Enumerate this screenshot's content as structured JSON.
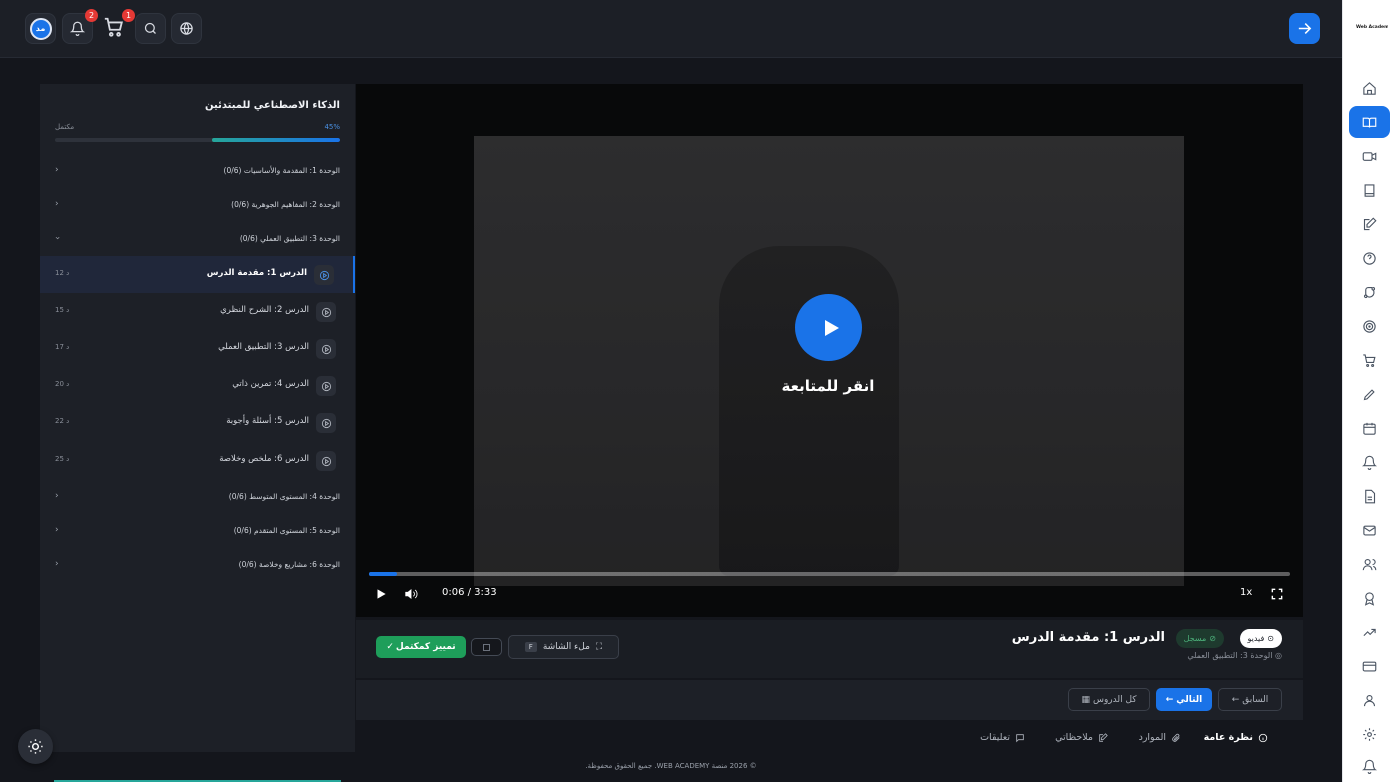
{
  "header": {
    "avatar_initials": "مد",
    "notifications_count": "2",
    "cart_count": "1"
  },
  "sidebar_logo": "Web Academy",
  "course": {
    "title": "الذكاء الاصطناعي للمبتدئين",
    "progress_label": "مكتمل",
    "progress_pct_text": "45%",
    "progress_value": 0.45,
    "units": [
      {
        "title": "الوحدة 1: المقدمة والأساسيات (0/6)",
        "expanded": false
      },
      {
        "title": "الوحدة 2: المفاهيم الجوهرية (0/6)",
        "expanded": false
      },
      {
        "title": "الوحدة 3: التطبيق العملي (0/6)",
        "expanded": true
      },
      {
        "title": "الوحدة 4: المستوى المتوسط (0/6)",
        "expanded": false
      },
      {
        "title": "الوحدة 5: المستوى المتقدم (0/6)",
        "expanded": false
      },
      {
        "title": "الوحدة 6: مشاريع وخلاصة (0/6)",
        "expanded": false
      }
    ],
    "lessons": [
      {
        "title": "الدرس 1: مقدمة الدرس",
        "duration": "12 د",
        "active": true
      },
      {
        "title": "الدرس 2: الشرح النظري",
        "duration": "15 د",
        "active": false
      },
      {
        "title": "الدرس 3: التطبيق العملي",
        "duration": "17 د",
        "active": false
      },
      {
        "title": "الدرس 4: تمرين ذاتي",
        "duration": "20 د",
        "active": false
      },
      {
        "title": "الدرس 5: أسئلة وأجوبة",
        "duration": "22 د",
        "active": false
      },
      {
        "title": "الدرس 6: ملخص وخلاصة",
        "duration": "25 د",
        "active": false
      }
    ]
  },
  "player": {
    "overlay_text": "انقر للمتابعة",
    "time": "0:06 / 3:33",
    "speed": "1x",
    "played_fraction": 0.03
  },
  "lesson_info": {
    "title": "الدرس 1: مقدمة الدرس",
    "tag_video": "فيديو",
    "tag_enrolled": "مسجل",
    "unit_crumb": "الوحدة 3: التطبيق العملي",
    "complete_label": "تمييز كمكتمل",
    "fullscreen_label": "ملء الشاشة",
    "fullscreen_key": "F"
  },
  "nav": {
    "prev": "السابق",
    "next": "التالي",
    "all_lessons": "كل الدروس"
  },
  "tabs": [
    {
      "label": "نظرة عامة",
      "active": true
    },
    {
      "label": "الموارد",
      "active": false
    },
    {
      "label": "ملاحظاتي",
      "active": false
    },
    {
      "label": "تعليقات",
      "active": false
    }
  ],
  "footer": "© 2026 منصة WEB ACADEMY. جميع الحقوق محفوظة."
}
